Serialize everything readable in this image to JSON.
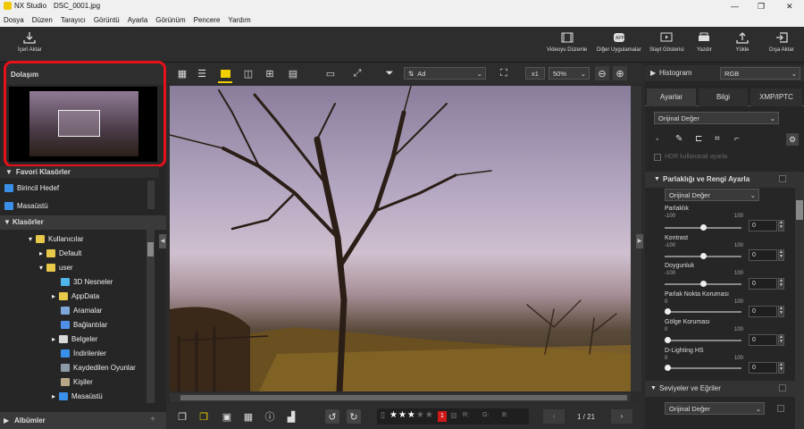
{
  "window": {
    "app": "NX Studio",
    "file": "DSC_0001.jpg"
  },
  "menu": [
    "Dosya",
    "Düzen",
    "Tarayıcı",
    "Görüntü",
    "Ayarla",
    "Görünüm",
    "Pencere",
    "Yardım"
  ],
  "toolbar": {
    "import": "İçeri Aktar",
    "video_editor": "Videoyu Düzenle",
    "other_apps": "Diğer Uygulamalar",
    "slideshow": "Slayt Gösterisi",
    "print": "Yazdır",
    "upload": "Yükle",
    "export": "Dışa Aktar"
  },
  "left": {
    "navigation": "Dolaşım",
    "favorites": "Favori Klasörler",
    "favorite_items": [
      "Birincil Hedef",
      "Masaüstü"
    ],
    "folders": "Klasörler",
    "tree": [
      {
        "label": "Kullanıcılar",
        "icon": "folder-icon",
        "color": "#e8c84a"
      },
      {
        "label": "Default",
        "icon": "folder-icon",
        "color": "#e8c84a"
      },
      {
        "label": "user",
        "icon": "folder-icon",
        "color": "#e8c84a"
      },
      {
        "label": "3D Nesneler",
        "icon": "3d-objects-icon",
        "color": "#4fb4e8"
      },
      {
        "label": "AppData",
        "icon": "folder-icon",
        "color": "#e8c84a"
      },
      {
        "label": "Aramalar",
        "icon": "search-icon",
        "color": "#7fa6d8"
      },
      {
        "label": "Bağlantılar",
        "icon": "link-icon",
        "color": "#4f8fe8"
      },
      {
        "label": "Belgeler",
        "icon": "documents-icon",
        "color": "#d8d8d8"
      },
      {
        "label": "İndirilenler",
        "icon": "download-icon",
        "color": "#3a8fe8"
      },
      {
        "label": "Kaydedilen Oyunlar",
        "icon": "games-icon",
        "color": "#8a9aa8"
      },
      {
        "label": "Kişiler",
        "icon": "contacts-icon",
        "color": "#b8a888"
      },
      {
        "label": "Masaüstü",
        "icon": "desktop-icon",
        "color": "#3a8fe8"
      }
    ],
    "albums": "Albümler"
  },
  "viewer": {
    "sort": "Ad",
    "zoom_x1": "x1",
    "zoom_percent": "50%",
    "rating_label": "1",
    "rgb_r": "R:",
    "rgb_g": "G:",
    "rgb_b": "B:",
    "page": "1 / 21",
    "stars": 3
  },
  "right": {
    "histogram": "Histogram",
    "histogram_mode": "RGB",
    "tabs": [
      "Ayarlar",
      "Bilgi",
      "XMP/IPTC"
    ],
    "preset": "Orijinal Değer",
    "hdr": "HDR kullanarak ayarla",
    "section_brightness": "Parlaklığı ve Rengi Ayarla",
    "section_preset": "Orijinal Değer",
    "brightness": {
      "label": "Parlaklık",
      "min": "-100",
      "max": "100",
      "value": "0",
      "level": 0.5
    },
    "contrast": {
      "label": "Kontrast",
      "min": "-100",
      "max": "100",
      "value": "0",
      "level": 0.5
    },
    "saturation": {
      "label": "Doygunluk",
      "min": "-100",
      "max": "100",
      "value": "0",
      "level": 0.5
    },
    "highlight": {
      "label": "Parlak Nokta Koruması",
      "min": "0",
      "max": "100",
      "value": "0",
      "level": 0
    },
    "shadow": {
      "label": "Gölge Koruması",
      "min": "0",
      "max": "100",
      "value": "0",
      "level": 0
    },
    "dlighting": {
      "label": "D-Lighting HS",
      "min": "0",
      "max": "100",
      "value": "0",
      "level": 0
    },
    "section_levels": "Seviyeler ve Eğriler",
    "levels_preset": "Orijinal Değer"
  },
  "colors": {
    "highlight_frame": "#e8101a",
    "accent": "#f0d000"
  }
}
